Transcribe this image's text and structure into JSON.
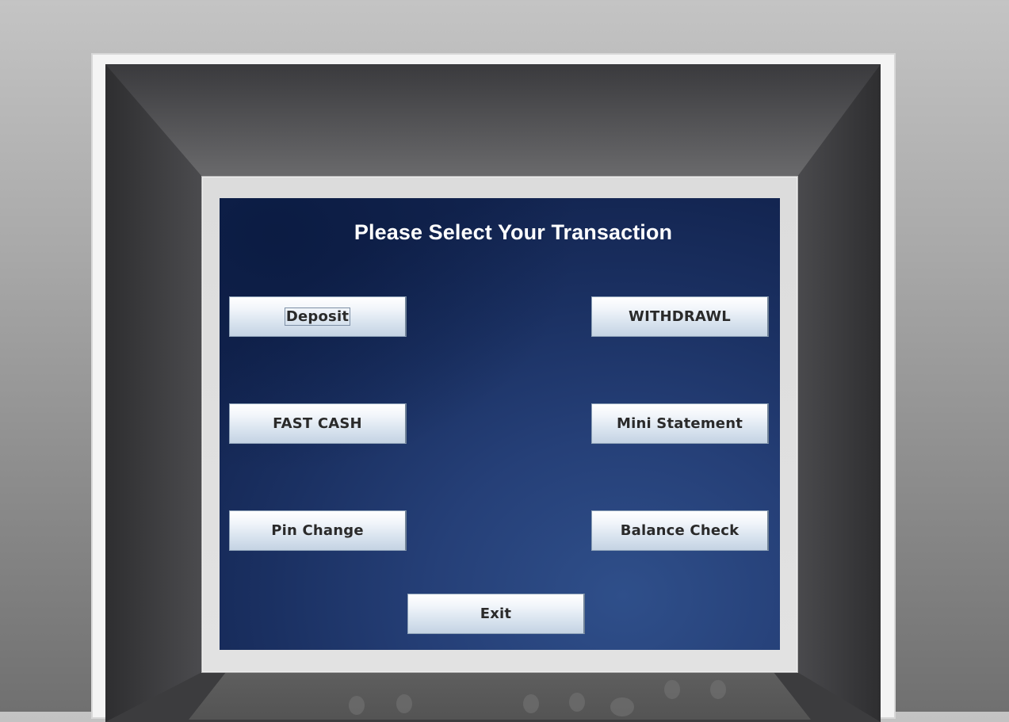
{
  "screen": {
    "title": "Please Select Your Transaction"
  },
  "buttons": {
    "deposit": "Deposit",
    "withdrawl": "WITHDRAWL",
    "fast_cash": "FAST CASH",
    "mini_statement": "Mini Statement",
    "pin_change": "Pin Change",
    "balance_check": "Balance Check",
    "exit": "Exit"
  },
  "colors": {
    "screen_bg": "#1f3a70",
    "title_text": "#ffffff",
    "button_text": "#2a2a2a",
    "machine_body": "#3c3c3e"
  }
}
